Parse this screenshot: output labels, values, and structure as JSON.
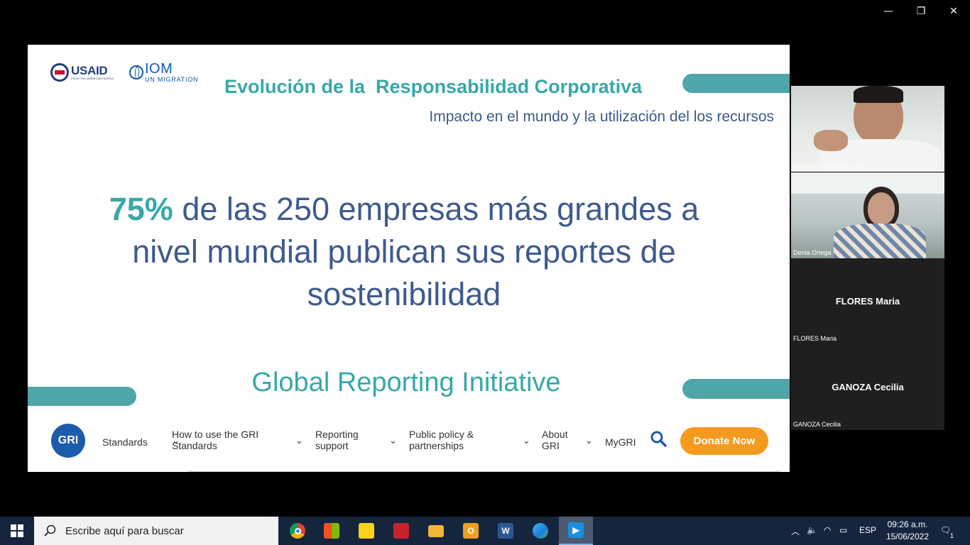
{
  "window": {
    "minimize_glyph": "—",
    "restore_glyph": "❐",
    "close_glyph": "✕"
  },
  "slide": {
    "logos": {
      "usaid": "USAID",
      "usaid_sub": "FROM THE AMERICAN PEOPLE",
      "iom": "IOM",
      "iom_sub": "UN MIGRATION"
    },
    "title": "Evolución de la  Responsabilidad Corporativa",
    "subtitle": "Impacto en el mundo y la utilización del los recursos",
    "stat_percent": "75%",
    "stat_line1": " de las 250 empresas más grandes a",
    "stat_line2": "nivel mundial publican sus reportes de",
    "stat_line3": "sostenibilidad",
    "gri_heading": "Global Reporting Initiative",
    "gri_nav": {
      "logo": "GRI",
      "items": [
        {
          "label": "Standards"
        },
        {
          "label": "How to use the GRI Standards"
        },
        {
          "label": "Reporting support"
        },
        {
          "label": "Public policy & partnerships"
        },
        {
          "label": "About GRI"
        },
        {
          "label": "MyGRI"
        }
      ],
      "donate": "Donate Now"
    }
  },
  "participants": [
    {
      "name": "Francisco Martinez - OIM",
      "video": true
    },
    {
      "name": "Denia Ortega",
      "video": true
    },
    {
      "name": "FLORES Maria",
      "tile_name": "FLORES Maria",
      "video": false
    },
    {
      "name": "GANOZA Cecilia",
      "tile_name": "GANOZA Cecilia",
      "video": false
    }
  ],
  "taskbar": {
    "search_placeholder": "Escribe aquí para buscar",
    "apps": [
      "chrome",
      "microsoft-store",
      "sticky-notes",
      "security-app",
      "file-explorer",
      "outlook",
      "word",
      "edge",
      "video-player"
    ],
    "language": "ESP",
    "time": "09:26 a.m.",
    "date": "15/06/2022",
    "notification_count": "1"
  },
  "colors": {
    "teal": "#37a8a8",
    "navy_text": "#3e5a8e",
    "donate_orange": "#f39a1f",
    "gri_blue": "#1c5cac",
    "taskbar": "#16253e"
  }
}
